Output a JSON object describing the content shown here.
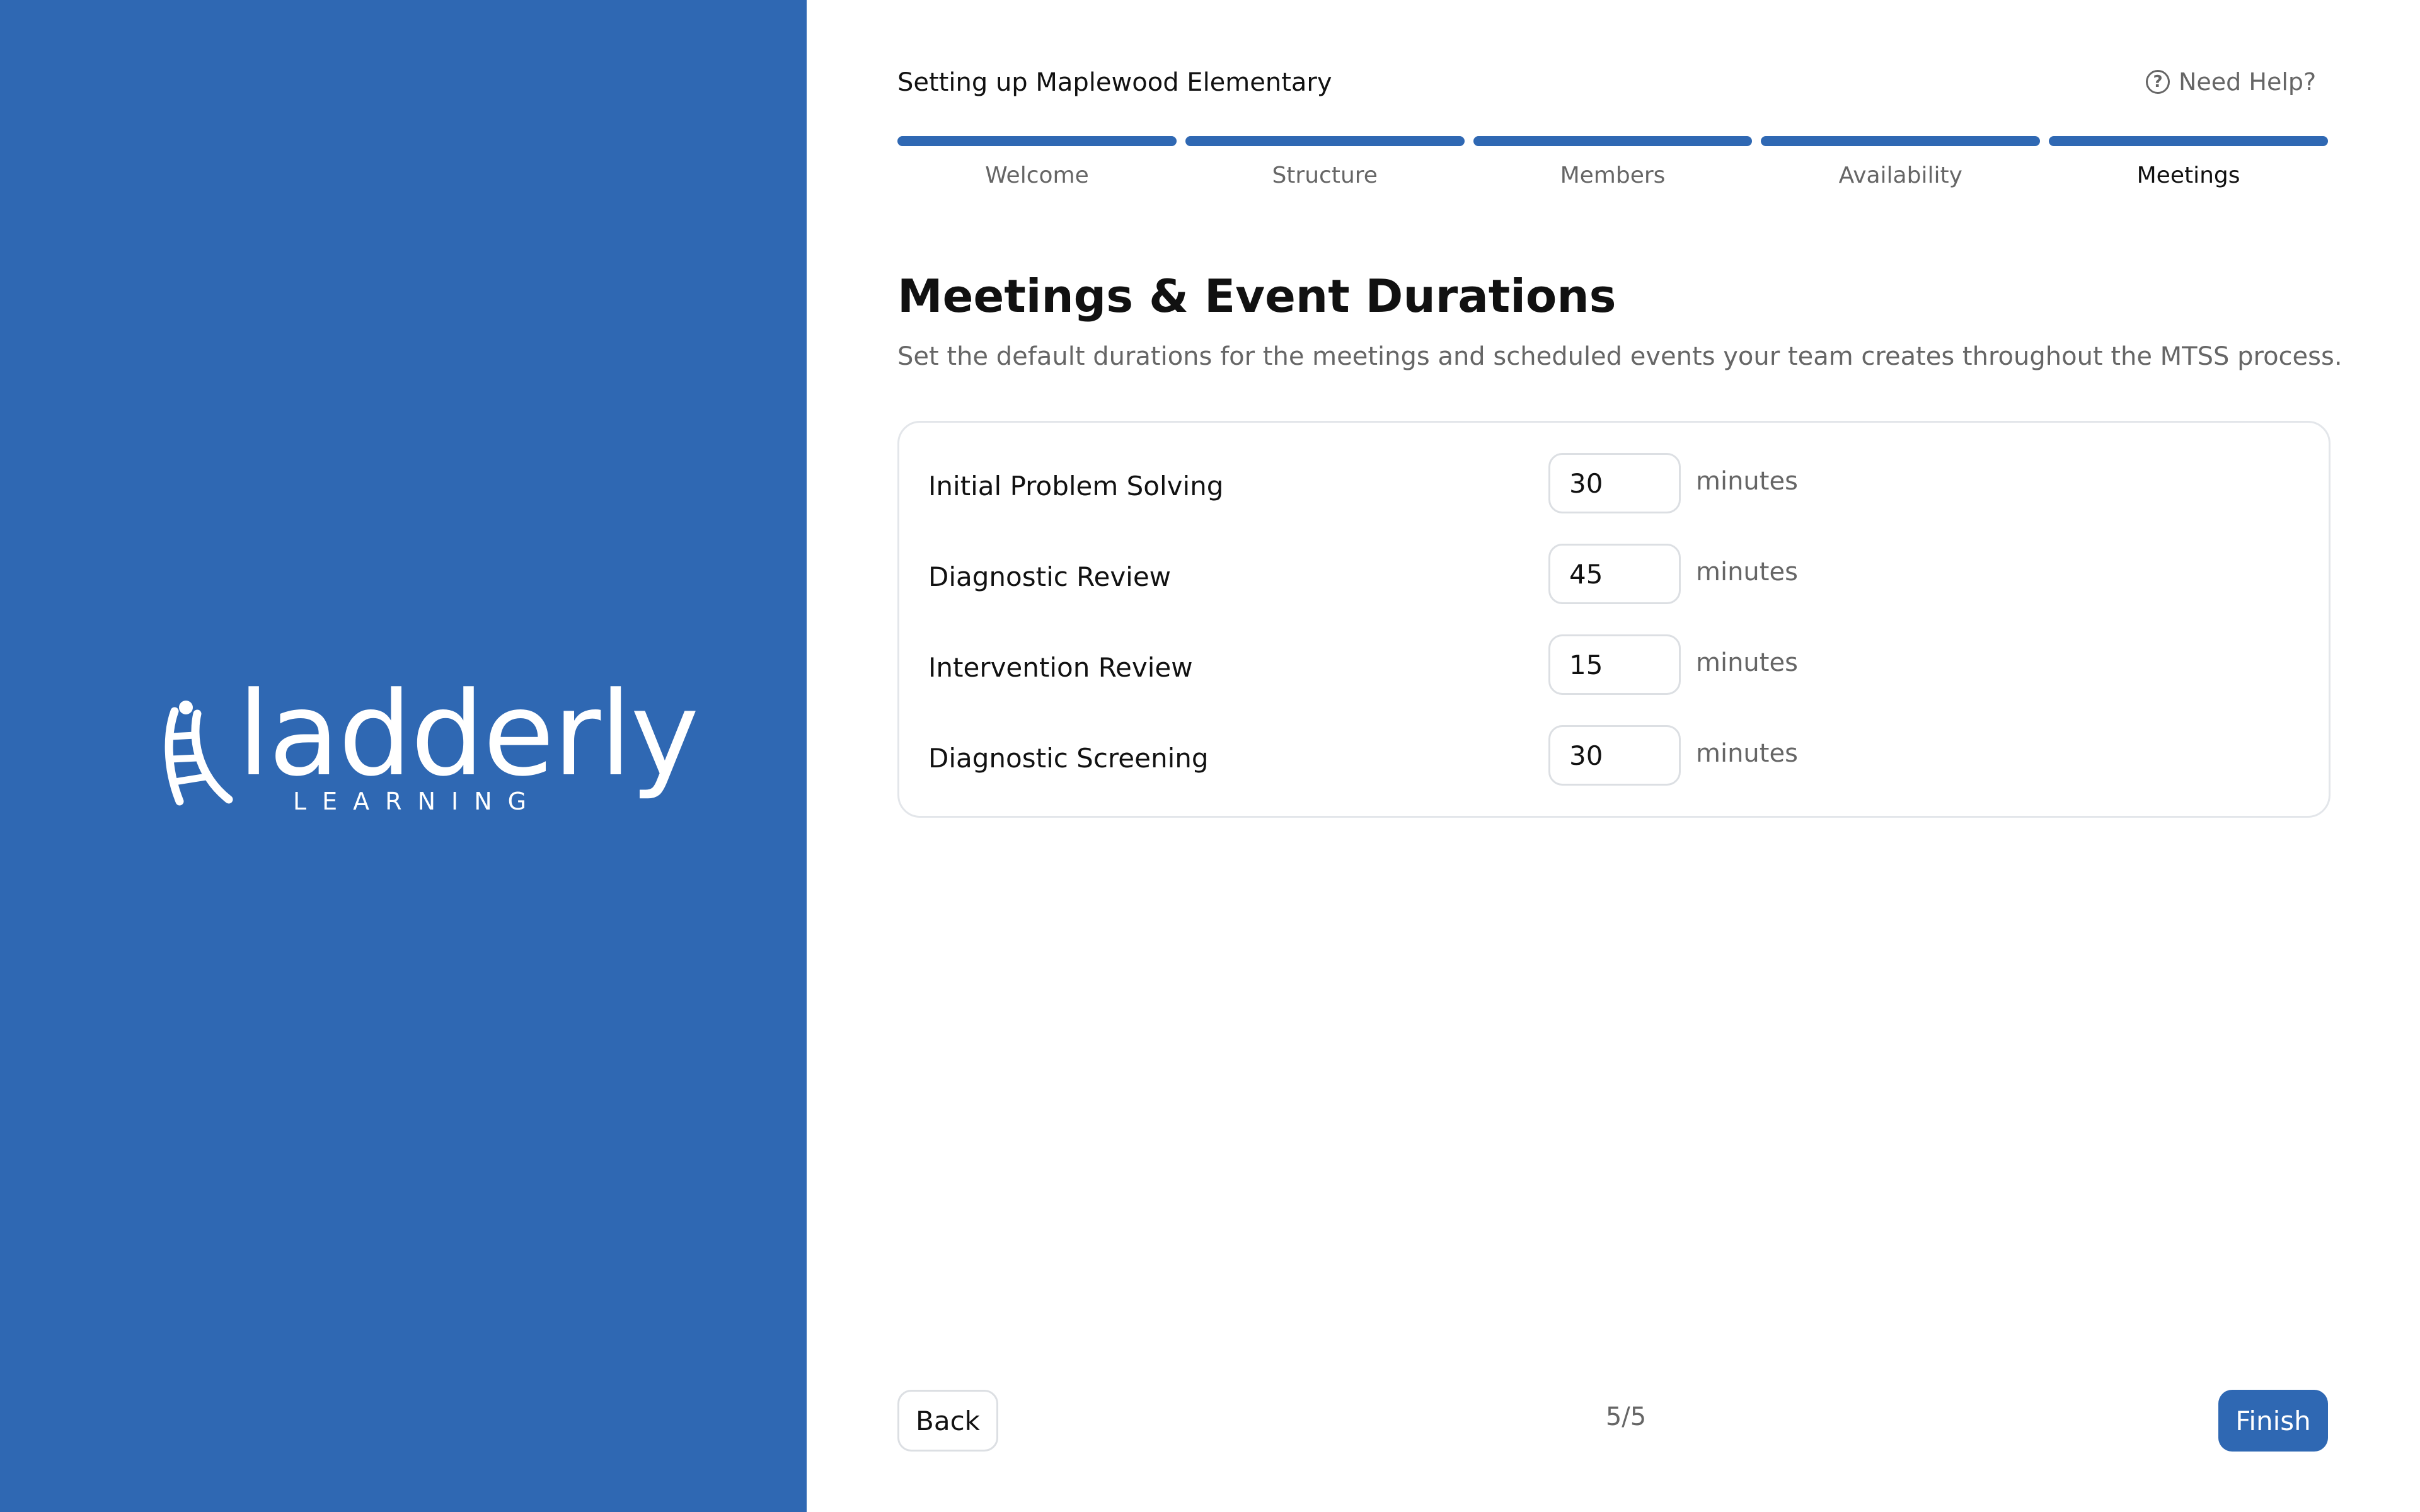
{
  "brand": {
    "name": "ladderly",
    "tagline": "LEARNING",
    "panel_color": "#2f68b3"
  },
  "header": {
    "title": "Setting up Maplewood Elementary",
    "help_label": "Need Help?",
    "help_icon": "question-circle-icon"
  },
  "steps": [
    {
      "label": "Welcome",
      "completed": true
    },
    {
      "label": "Structure",
      "completed": true
    },
    {
      "label": "Members",
      "completed": true
    },
    {
      "label": "Availability",
      "completed": true
    },
    {
      "label": "Meetings",
      "completed": true,
      "active": true
    }
  ],
  "content": {
    "title": "Meetings & Event Durations",
    "subtitle": "Set the default durations for the meetings and scheduled events your team creates throughout the MTSS process."
  },
  "durations": [
    {
      "label": "Initial Problem Solving",
      "value": "30",
      "unit": "minutes"
    },
    {
      "label": "Diagnostic Review",
      "value": "45",
      "unit": "minutes"
    },
    {
      "label": "Intervention Review",
      "value": "15",
      "unit": "minutes"
    },
    {
      "label": "Diagnostic Screening",
      "value": "30",
      "unit": "minutes"
    }
  ],
  "footer": {
    "back_label": "Back",
    "page_indicator": "5/5",
    "finish_label": "Finish"
  },
  "colors": {
    "accent": "#2f68b3",
    "text": "#111111",
    "muted": "#666666",
    "border": "#dcdfe3"
  }
}
